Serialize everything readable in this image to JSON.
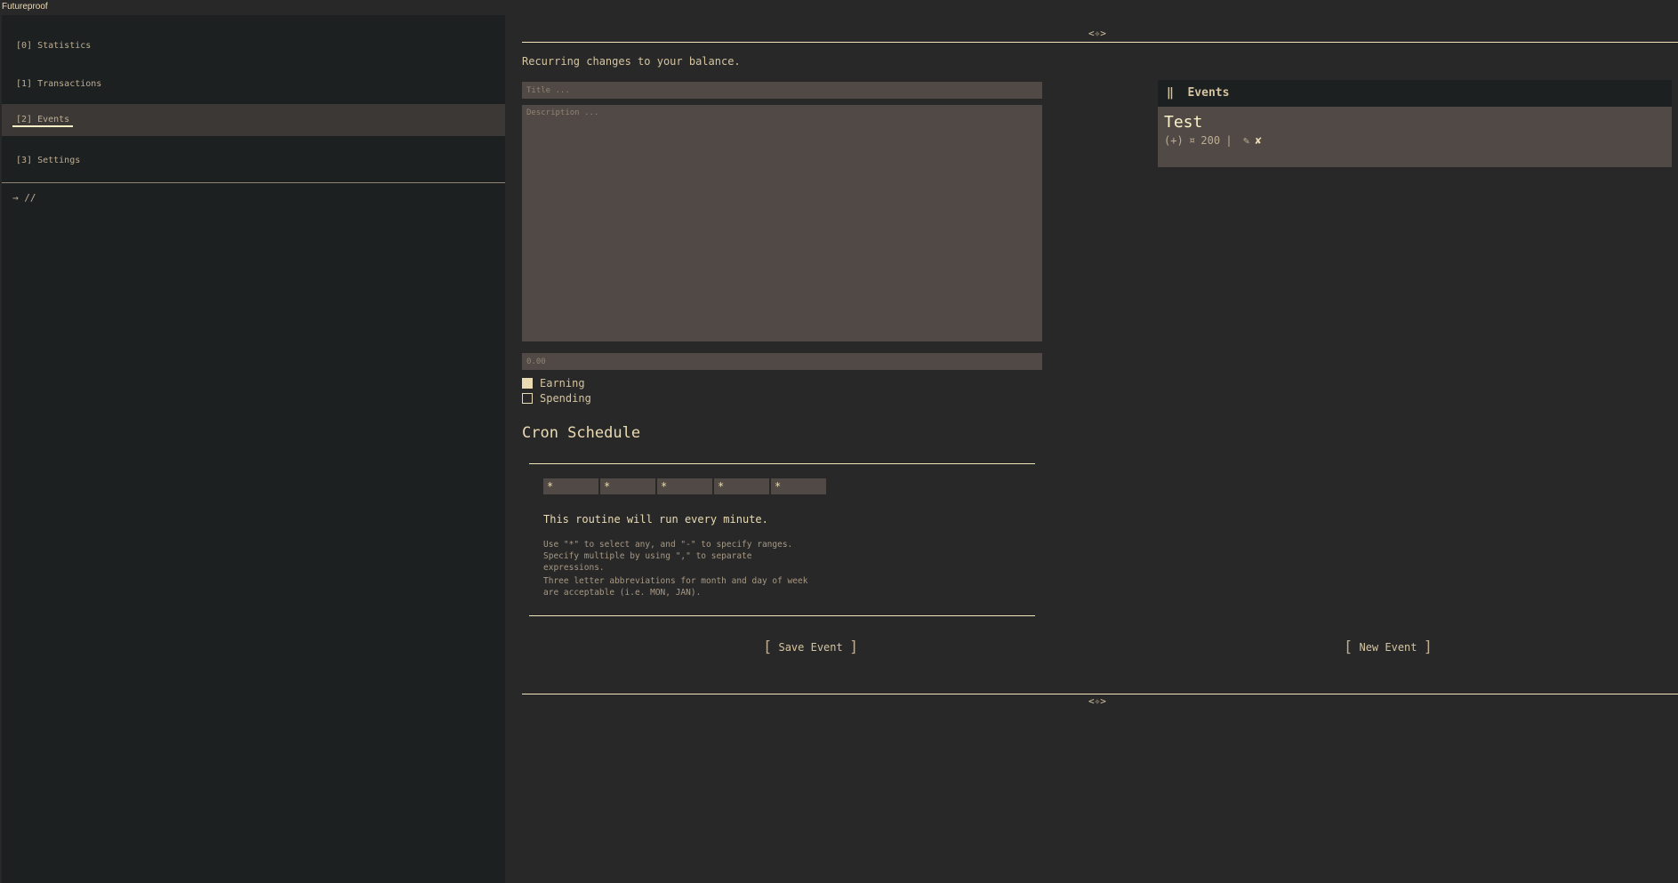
{
  "app": {
    "title": "Futureproof"
  },
  "sidebar": {
    "items": [
      {
        "label": "[0] Statistics"
      },
      {
        "label": "[1] Transactions"
      },
      {
        "label": "[2] Events",
        "active": true
      },
      {
        "label": "[3] Settings"
      }
    ],
    "breadcrumb": "→ //"
  },
  "main": {
    "ornament": "<✧>",
    "subtitle": "Recurring changes to your balance.",
    "form": {
      "title_placeholder": "Title ...",
      "description_placeholder": "Description ...",
      "amount_placeholder": "0.00",
      "earning_label": "Earning",
      "spending_label": "Spending",
      "earning_checked": true,
      "spending_checked": false
    },
    "cron": {
      "heading": "Cron Schedule",
      "fields": [
        "*",
        "*",
        "*",
        "*",
        "*"
      ],
      "summary": "This routine will run every minute.",
      "help1": "Use \"*\" to select any, and \"-\" to specify ranges. Specify multiple by using \",\" to separate expressions.",
      "help2": "Three letter abbreviations for month and day of week are acceptable (i.e. MON, JAN)."
    },
    "save_button": "Save Event",
    "new_button": "New Event"
  },
  "events": {
    "header": "Events",
    "header_icon": "‖",
    "items": [
      {
        "title": "Test",
        "sign": "(+)",
        "currency": "¤",
        "amount": "200",
        "sep": "|"
      }
    ]
  },
  "colors": {
    "bg": "#282828",
    "sidebar": "#1d2021",
    "input": "#504945",
    "accent": "#f2e5bc"
  }
}
